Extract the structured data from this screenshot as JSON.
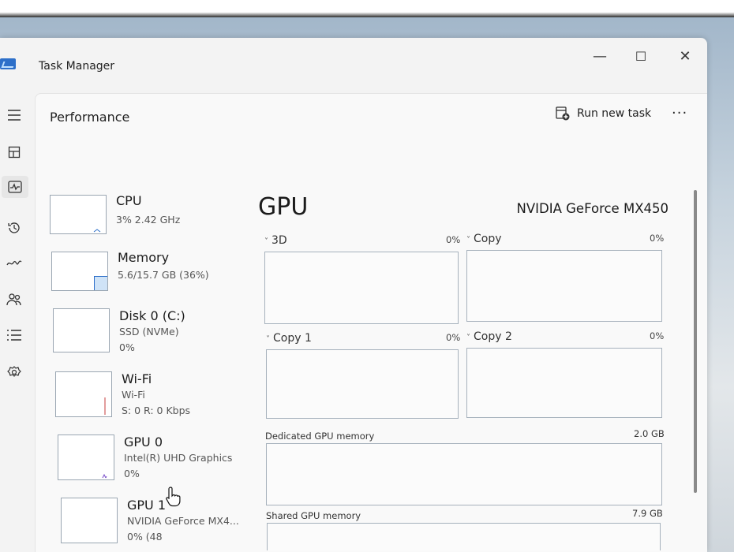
{
  "app": {
    "title": "Task Manager"
  },
  "window_controls": {
    "minimize": "—",
    "maximize": "☐",
    "close": "✕"
  },
  "header": {
    "page_title": "Performance",
    "run_new_task": "Run new task",
    "more": "···"
  },
  "devices": [
    {
      "name": "CPU",
      "line1": "3% 2.42 GHz",
      "line2": ""
    },
    {
      "name": "Memory",
      "line1": "5.6/15.7 GB (36%)",
      "line2": ""
    },
    {
      "name": "Disk 0 (C:)",
      "line1": "SSD (NVMe)",
      "line2": "0%"
    },
    {
      "name": "Wi-Fi",
      "line1": "Wi-Fi",
      "line2": "S: 0 R: 0 Kbps"
    },
    {
      "name": "GPU 0",
      "line1": "Intel(R) UHD Graphics",
      "line2": "0%"
    },
    {
      "name": "GPU 1",
      "line1": "NVIDIA GeForce MX4...",
      "line2": "0% (48"
    }
  ],
  "detail": {
    "title": "GPU",
    "model": "NVIDIA GeForce MX450",
    "engines": [
      {
        "label": "3D",
        "percent": "0%"
      },
      {
        "label": "Copy",
        "percent": "0%"
      },
      {
        "label": "Copy 1",
        "percent": "0%"
      },
      {
        "label": "Copy 2",
        "percent": "0%"
      }
    ],
    "dedicated_memory": {
      "label": "Dedicated GPU memory",
      "max": "2.0 GB"
    },
    "shared_memory": {
      "label": "Shared GPU memory",
      "max": "7.9 GB"
    }
  },
  "colors": {
    "accent": "#2d6fc9",
    "graph_border": "#a6b1bc",
    "memory_fill": "#cfe3f7"
  }
}
